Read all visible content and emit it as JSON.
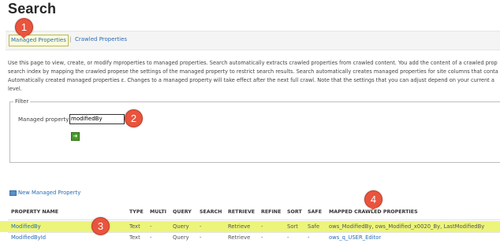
{
  "page": {
    "title": "Search"
  },
  "tabs": {
    "managed": "Managed Properties",
    "separator": "|",
    "crawled": "Crawled Properties"
  },
  "description": {
    "line1": "Use this page to view, create, or modify mproperties to managed properties. Search automatically extracts crawled properties from crawled content. You add the content of a crawled prop",
    "line2": "search index by mapping the crawled propese the settings of the managed property to restrict search results. Search automatically creates managed properties for site columns that conta",
    "line3": "Automatically created managed properties ε. Changes to a managed property will take effect after the next full crawl. Note that the settings that you can adjust depend on your current a",
    "line4": "level."
  },
  "filter": {
    "legend": "Filter",
    "label": "Managed property",
    "value": "modifiedBy",
    "go_icon": "arrow-right-icon"
  },
  "new_property": {
    "label": "New Managed Property",
    "icon": "new-property-icon"
  },
  "table": {
    "headers": [
      "PROPERTY NAME",
      "TYPE",
      "MULTI",
      "QUERY",
      "SEARCH",
      "RETRIEVE",
      "REFINE",
      "SORT",
      "SAFE",
      "MAPPED CRAWLED PROPERTIES"
    ],
    "rows": [
      [
        "ModifiedBy",
        "Text",
        "-",
        "Query",
        "-",
        "Retrieve",
        "-",
        "Sort",
        "Safe",
        "ows_ModifiedBy, ows_Modified_x0020_By, LastModifiedBy"
      ],
      [
        "ModifiedById",
        "Text",
        "-",
        "Query",
        "-",
        "Retrieve",
        "-",
        "-",
        "-",
        "ows_q_USER_Editor"
      ]
    ]
  },
  "annotations": [
    "1",
    "2",
    "3",
    "4"
  ],
  "colors": {
    "highlight": "#ecf57a",
    "badge": "#e9543e",
    "link": "#2a6db3"
  }
}
